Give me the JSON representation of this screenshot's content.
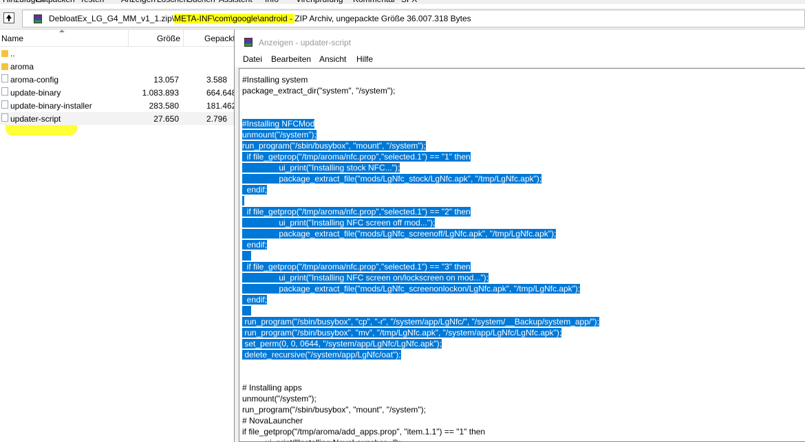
{
  "menu_strip": [
    "Hinzufügen",
    "Entpacken",
    "Testen",
    "Anzeigen",
    "Löschen",
    "Suchen",
    "Assistent",
    "Info",
    "Virenprüfung",
    "Kommentar",
    "SFX"
  ],
  "path_bar": {
    "prefix": "DebloatEx_LG_G4_MM_v1_1.zip\\",
    "highlighted": "META-INF\\com\\google\\android - ",
    "suffix": "ZIP Archiv, ungepackte Größe 36.007.318 Bytes"
  },
  "file_list": {
    "columns": {
      "name": "Name",
      "size": "Größe",
      "packed": "Gepackt"
    },
    "rows": [
      {
        "name": "..",
        "size": "",
        "packed": "",
        "type": "folder"
      },
      {
        "name": "aroma",
        "size": "",
        "packed": "",
        "type": "folder"
      },
      {
        "name": "aroma-config",
        "size": "13.057",
        "packed": "3.588",
        "type": "file"
      },
      {
        "name": "update-binary",
        "size": "1.083.893",
        "packed": "664.648",
        "type": "file"
      },
      {
        "name": "update-binary-installer",
        "size": "283.580",
        "packed": "181.462",
        "type": "file"
      },
      {
        "name": "updater-script",
        "size": "27.650",
        "packed": "2.796",
        "type": "file"
      }
    ]
  },
  "viewer": {
    "title": "Anzeigen - updater-script",
    "menu": [
      "Datei",
      "Bearbeiten",
      "Ansicht",
      "Hilfe"
    ],
    "lines": [
      {
        "text": "#Installing system",
        "sel": false
      },
      {
        "text": "package_extract_dir(\"system\", \"/system\");",
        "sel": false
      },
      {
        "text": "",
        "sel": false
      },
      {
        "text": "",
        "sel": false
      },
      {
        "text": "#Installing NFCMod",
        "sel": true
      },
      {
        "text": "unmount(\"/system\");",
        "sel": true
      },
      {
        "text": "run_program(\"/sbin/busybox\", \"mount\", \"/system\");",
        "sel": true
      },
      {
        "text": "  if file_getprop(\"/tmp/aroma/nfc.prop\",\"selected.1\") == \"1\" then",
        "sel": true
      },
      {
        "text": "                ui_print(\"Installing stock NFC...\");",
        "sel": true
      },
      {
        "text": "                package_extract_file(\"mods/LgNfc_stock/LgNfc.apk\", \"/tmp/LgNfc.apk\");",
        "sel": true
      },
      {
        "text": "  endif;",
        "sel": true
      },
      {
        "text": " ",
        "sel": true
      },
      {
        "text": "  if file_getprop(\"/tmp/aroma/nfc.prop\",\"selected.1\") == \"2\" then",
        "sel": true
      },
      {
        "text": "                ui_print(\"Installing NFC screen off mod...\");",
        "sel": true
      },
      {
        "text": "                package_extract_file(\"mods/LgNfc_screenoff/LgNfc.apk\", \"/tmp/LgNfc.apk\");",
        "sel": true
      },
      {
        "text": "  endif;",
        "sel": true
      },
      {
        "text": "    ",
        "sel": true
      },
      {
        "text": "  if file_getprop(\"/tmp/aroma/nfc.prop\",\"selected.1\") == \"3\" then",
        "sel": true
      },
      {
        "text": "                ui_print(\"Installing NFC screen on/lockscreen on mod...\");",
        "sel": true
      },
      {
        "text": "                package_extract_file(\"mods/LgNfc_screenonlockon/LgNfc.apk\", \"/tmp/LgNfc.apk\");",
        "sel": true
      },
      {
        "text": "  endif;",
        "sel": true
      },
      {
        "text": "    ",
        "sel": true
      },
      {
        "text": " run_program(\"/sbin/busybox\", \"cp\", \"-r\", \"/system/app/LgNfc/\", \"/system/__Backup/system_app/\");",
        "sel": true
      },
      {
        "text": " run_program(\"/sbin/busybox\", \"mv\", \"/tmp/LgNfc.apk\", \"/system/app/LgNfc/LgNfc.apk\");",
        "sel": true
      },
      {
        "text": " set_perm(0, 0, 0644, \"/system/app/LgNfc/LgNfc.apk\");",
        "sel": true
      },
      {
        "text": " delete_recursive(\"/system/app/LgNfc/oat\");",
        "sel": true
      },
      {
        "text": "",
        "sel": false
      },
      {
        "text": "",
        "sel": false
      },
      {
        "text": "# Installing apps",
        "sel": false
      },
      {
        "text": "unmount(\"/system\");",
        "sel": false
      },
      {
        "text": "run_program(\"/sbin/busybox\", \"mount\", \"/system\");",
        "sel": false
      },
      {
        "text": "# NovaLauncher",
        "sel": false
      },
      {
        "text": "if file_getprop(\"/tmp/aroma/add_apps.prop\", \"item.1.1\") == \"1\" then",
        "sel": false
      },
      {
        "text": "          ui_print(\"Installing NovaLauncher...\");",
        "sel": false
      }
    ]
  }
}
